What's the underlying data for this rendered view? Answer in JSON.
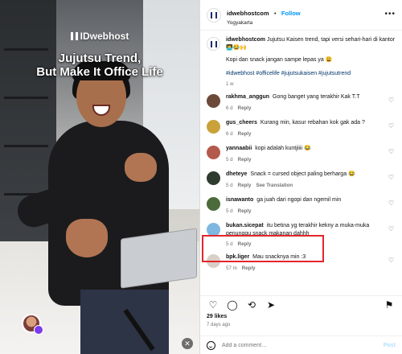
{
  "video": {
    "brand": "IDwebhost",
    "headline_line1": "Jujutsu Trend,",
    "headline_line2": "But Make It Office Life"
  },
  "header": {
    "username": "idwebhostcom",
    "separator": "•",
    "follow_label": "Follow",
    "location": "Yogyakarta"
  },
  "caption": {
    "username": "idwebhostcom",
    "text": "Jujutsu Kaisen trend, tapi versi sehari-hari di kantor 👨‍💻😂🙌",
    "line2": "Kopi dan snack jangan sampe lepas ya 😩",
    "hashtags": "#idwebhost #officelife #jujutsukaisen #jujutsutrend",
    "age": "1 w"
  },
  "comments": [
    {
      "user": "rakhma_anggun",
      "text": "Gong banget yang terakhir Kak T.T",
      "age": "6 d",
      "reply": "Reply",
      "extra": "",
      "avatar_color": "#6b4a3a"
    },
    {
      "user": "gus_cheers",
      "text": "Kurang min, kasur rebahan kok gak ada ?",
      "age": "6 d",
      "reply": "Reply",
      "extra": "",
      "avatar_color": "#c9a23a"
    },
    {
      "user": "yannaabii",
      "text": "kopi adalah kuntjiiii 😂",
      "age": "5 d",
      "reply": "Reply",
      "extra": "",
      "avatar_color": "#b35a4c"
    },
    {
      "user": "dheteye",
      "text": "Snack = cursed object paling berharga 😂",
      "age": "5 d",
      "reply": "Reply",
      "extra": "See Translation",
      "avatar_color": "#2f3b2e"
    },
    {
      "user": "isnawanto",
      "text": "ga juah dari ngopi dan ngemil min",
      "age": "5 d",
      "reply": "Reply",
      "extra": "",
      "avatar_color": "#4c6b3a"
    },
    {
      "user": "bukan.sicepat",
      "text": "itu betina yg terakhir kekny a muka-muka penunggu snack makanan dahhh",
      "age": "5 d",
      "reply": "Reply",
      "extra": "",
      "avatar_color": "#7fb7e0"
    },
    {
      "user": "bpk.liger",
      "text": "Mau snacknya min :3",
      "age": "57 m",
      "reply": "Reply",
      "extra": "",
      "avatar_color": "#d9cfc6"
    }
  ],
  "stats": {
    "likes": "29 likes",
    "posted": "7 days ago"
  },
  "add_comment": {
    "placeholder": "Add a comment…",
    "post_label": "Post"
  },
  "colors": {
    "accent": "#0095f6",
    "highlight": "#e3262d",
    "hashtag": "#00376b"
  }
}
